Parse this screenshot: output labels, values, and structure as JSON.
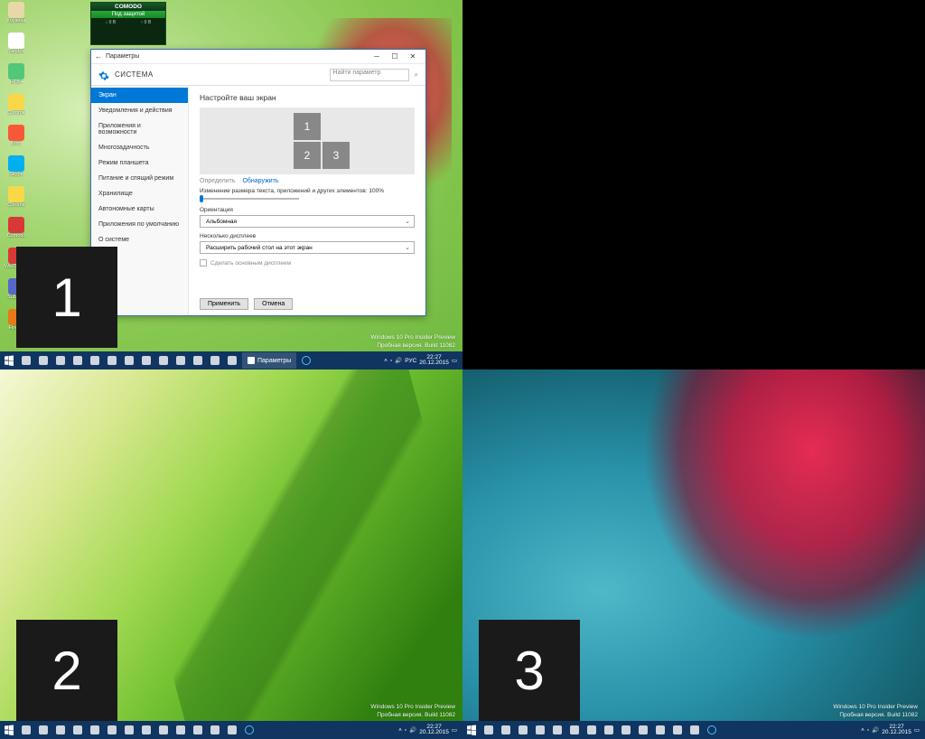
{
  "badges": {
    "b1": "1",
    "b2": "2",
    "b3": "3"
  },
  "watermark": {
    "l1": "Windows 10 Pro Insider Preview",
    "l2": "Пробная версия. Build 11082"
  },
  "watermark_q1": {
    "l1": "Windows 10 Pro Insider Preview",
    "l2": "Пробная версия. Build 11082"
  },
  "comodo": {
    "title": "COMODO",
    "status": "Под защитой"
  },
  "desktop": [
    {
      "lbl": "Корзина",
      "color": "#e8d8a8"
    },
    {
      "lbl": "Yandex",
      "color": "#fff"
    },
    {
      "lbl": "НТВ+",
      "color": "#50c878"
    },
    {
      "lbl": "Chrome",
      "color": "#f8d848"
    },
    {
      "lbl": "Фото",
      "color": "#f85838"
    },
    {
      "lbl": "Skype",
      "color": "#00aff0"
    },
    {
      "lbl": "Chrome",
      "color": "#f8d848"
    },
    {
      "lbl": "Comodo",
      "color": "#d83838"
    },
    {
      "lbl": "WinDirStat",
      "color": "#d83838"
    },
    {
      "lbl": "Sublime",
      "color": "#5868c8"
    },
    {
      "lbl": "Firefox",
      "color": "#e87818"
    }
  ],
  "settings": {
    "window_title": "Параметры",
    "header_title": "СИСТЕМА",
    "search_placeholder": "Найти параметр",
    "sidebar": [
      "Экран",
      "Уведомления и действия",
      "Приложения и возможности",
      "Многозадачность",
      "Режим планшета",
      "Питание и спящий режим",
      "Хранилище",
      "Автономные карты",
      "Приложения по умолчанию",
      "О системе"
    ],
    "content": {
      "heading": "Настройте ваш экран",
      "identify": "Определить",
      "detect": "Обнаружить",
      "scale_label": "Изменение размера текста, приложений и других элементов: 100%",
      "orientation_label": "Ориентация",
      "orientation_value": "Альбомная",
      "multi_label": "Несколько дисплеев",
      "multi_value": "Расширить рабочий стол на этот экран",
      "make_main": "Сделать основным дисплеем",
      "apply": "Применить",
      "cancel": "Отмена",
      "mon1": "1",
      "mon2": "2",
      "mon3": "3"
    }
  },
  "taskbar": {
    "active_app": "Параметры",
    "lang": "РУС",
    "time": "22:27",
    "date": "20.12.2015"
  }
}
